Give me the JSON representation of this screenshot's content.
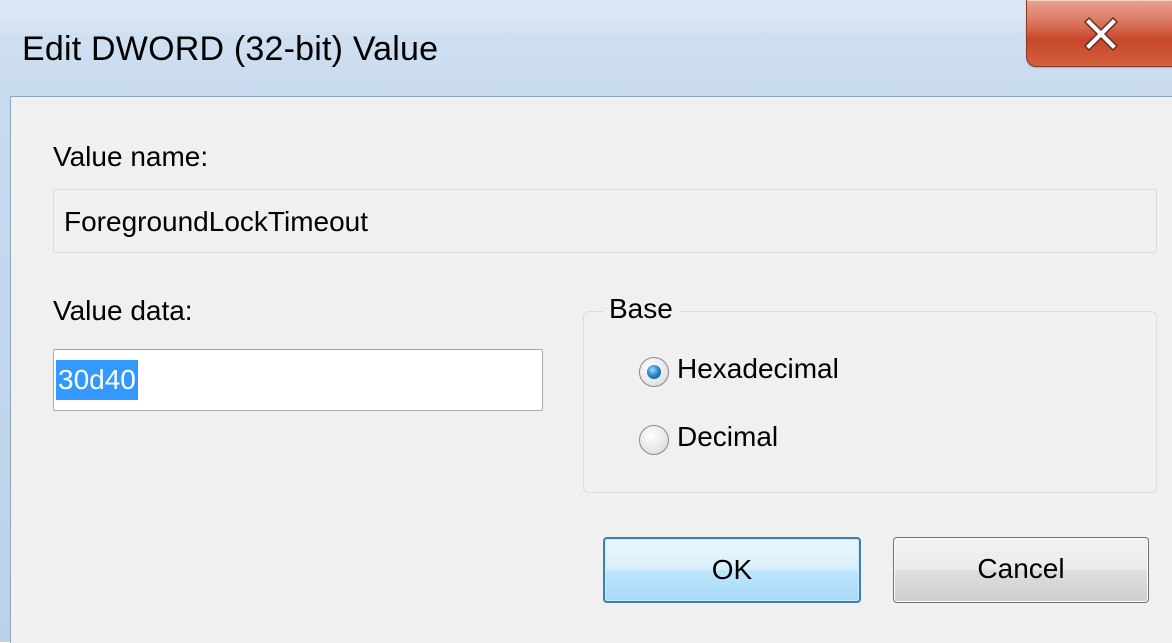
{
  "window": {
    "title": "Edit DWORD (32-bit) Value",
    "close_icon": "close-icon"
  },
  "value_name": {
    "label": "Value name:",
    "value": "ForegroundLockTimeout"
  },
  "value_data": {
    "label": "Value data:",
    "value": "30d40",
    "selected": true
  },
  "base": {
    "legend": "Base",
    "options": [
      {
        "label": "Hexadecimal",
        "checked": true
      },
      {
        "label": "Decimal",
        "checked": false
      }
    ]
  },
  "buttons": {
    "ok_label": "OK",
    "cancel_label": "Cancel"
  },
  "colors": {
    "selection": "#3399ff",
    "close_button": "#c7462a",
    "ok_border": "#3c7fb1"
  }
}
